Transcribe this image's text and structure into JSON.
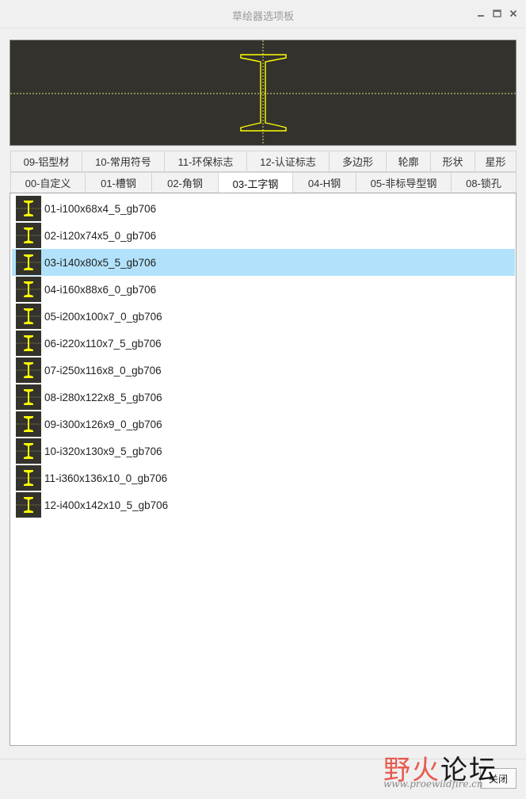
{
  "window": {
    "title": "草绘器选项板",
    "minimize_icon": "minimize-icon",
    "maximize_icon": "maximize-icon",
    "close_icon": "close-icon"
  },
  "preview": {
    "background": "#33322c",
    "shape_color": "#ffff00",
    "axis_color": "#e8e07a"
  },
  "tabs_row1": [
    {
      "label": "09-铝型材"
    },
    {
      "label": "10-常用符号"
    },
    {
      "label": "11-环保标志"
    },
    {
      "label": "12-认证标志"
    },
    {
      "label": "多边形"
    },
    {
      "label": "轮廓"
    },
    {
      "label": "形状"
    },
    {
      "label": "星形"
    }
  ],
  "tabs_row2": [
    {
      "label": "00-自定义"
    },
    {
      "label": "01-槽钢"
    },
    {
      "label": "02-角钢"
    },
    {
      "label": "03-工字钢",
      "active": true
    },
    {
      "label": "04-H钢"
    },
    {
      "label": "05-非标导型钢"
    },
    {
      "label": "08-锁孔"
    }
  ],
  "items": [
    {
      "label": "01-i100x68x4_5_gb706"
    },
    {
      "label": "02-i120x74x5_0_gb706"
    },
    {
      "label": "03-i140x80x5_5_gb706",
      "selected": true
    },
    {
      "label": "04-i160x88x6_0_gb706"
    },
    {
      "label": "05-i200x100x7_0_gb706"
    },
    {
      "label": "06-i220x110x7_5_gb706"
    },
    {
      "label": "07-i250x116x8_0_gb706"
    },
    {
      "label": "08-i280x122x8_5_gb706"
    },
    {
      "label": "09-i300x126x9_0_gb706"
    },
    {
      "label": "10-i320x130x9_5_gb706"
    },
    {
      "label": "11-i360x136x10_0_gb706"
    },
    {
      "label": "12-i400x142x10_5_gb706"
    }
  ],
  "footer": {
    "close_label": "关闭"
  },
  "watermark": {
    "text_a": "野火",
    "text_b": "论坛",
    "url": "www.proewildfire.cn"
  },
  "colors": {
    "selected_row": "#b2e2fb",
    "thumbnail_bg": "#33322c"
  }
}
